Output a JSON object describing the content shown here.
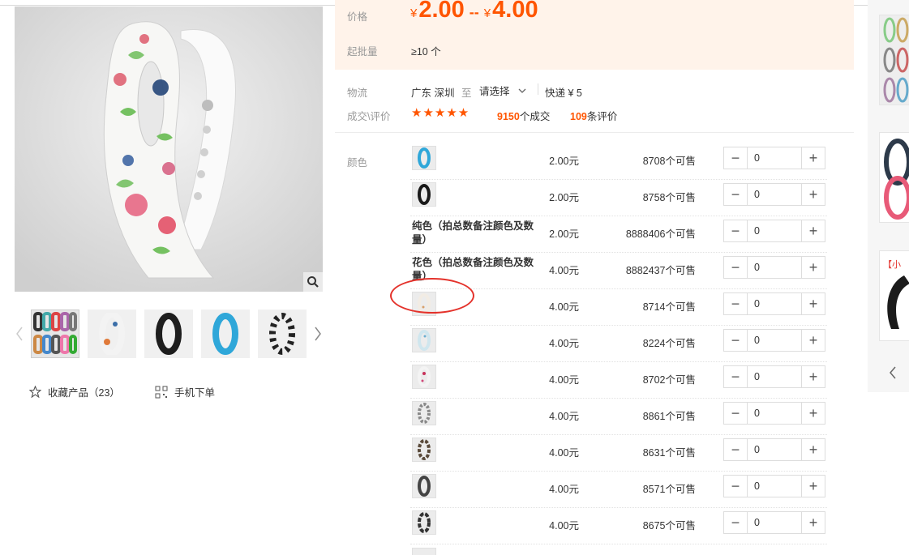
{
  "price": {
    "label": "价格",
    "currency": "¥",
    "low": "2.00",
    "separator": "--",
    "high": "4.00"
  },
  "moq": {
    "label": "起批量",
    "value": "≥10 个"
  },
  "logistics": {
    "label": "物流",
    "origin": "广东 深圳",
    "to": "至",
    "destination": "请选择",
    "shipping": "快递 ¥ 5"
  },
  "reviews": {
    "label": "成交\\评价",
    "stars": "★★★★★",
    "deals_count": "9150",
    "deals_unit": "个成交",
    "reviews_count": "109",
    "reviews_unit": "条评价"
  },
  "color_label": "颜色",
  "favorite": {
    "label": "收藏产品（23）",
    "mobile": "手机下单"
  },
  "skus": [
    {
      "name": "",
      "thumb": "blue",
      "price": "2.00元",
      "stock": "8708个可售",
      "qty": "0"
    },
    {
      "name": "",
      "thumb": "black",
      "price": "2.00元",
      "stock": "8758个可售",
      "qty": "0"
    },
    {
      "name": "纯色（拍总数备注颜色及数量）",
      "thumb": "",
      "price": "2.00元",
      "stock": "8888406个可售",
      "qty": "0"
    },
    {
      "name": "花色（拍总数备注颜色及数量）",
      "thumb": "",
      "price": "4.00元",
      "stock": "8882437个可售",
      "qty": "0"
    },
    {
      "name": "",
      "thumb": "cream",
      "price": "4.00元",
      "stock": "8714个可售",
      "qty": "0"
    },
    {
      "name": "",
      "thumb": "lightblue",
      "price": "4.00元",
      "stock": "8224个可售",
      "qty": "0"
    },
    {
      "name": "",
      "thumb": "pink",
      "price": "4.00元",
      "stock": "8702个可售",
      "qty": "0"
    },
    {
      "name": "",
      "thumb": "gray",
      "price": "4.00元",
      "stock": "8861个可售",
      "qty": "0"
    },
    {
      "name": "",
      "thumb": "brown",
      "price": "4.00元",
      "stock": "8631个可售",
      "qty": "0"
    },
    {
      "name": "",
      "thumb": "darkgray",
      "price": "4.00元",
      "stock": "8571个可售",
      "qty": "0"
    },
    {
      "name": "",
      "thumb": "charcoal",
      "price": "4.00元",
      "stock": "8675个可售",
      "qty": "0"
    }
  ],
  "sidebar": {
    "ad_text": "【小"
  },
  "colors": {
    "accent": "#ff5500",
    "price_bg": "#fff3ea",
    "highlight_circle": "#e4322b"
  },
  "icons": [
    "search-icon",
    "chevron-left-icon",
    "chevron-right-icon",
    "star-outline-icon",
    "qr-code-icon",
    "chevron-down-icon",
    "minus-icon",
    "plus-icon"
  ]
}
